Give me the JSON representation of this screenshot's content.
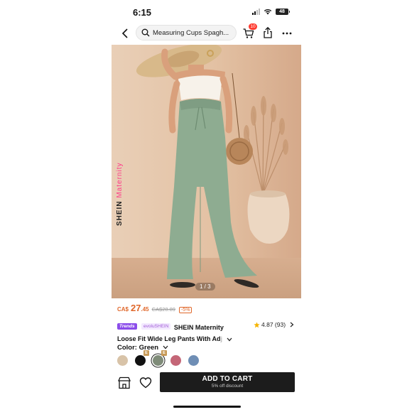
{
  "status_bar": {
    "time": "6:15",
    "battery": "48"
  },
  "nav": {
    "search_text": "Measuring Cups Spagh...",
    "cart_count": "10"
  },
  "hero": {
    "watermark_brand": "SHEIN",
    "watermark_accent": "Maternity",
    "page_indicator": "1 / 3"
  },
  "product": {
    "price_prefix": "CA$",
    "price_main": "27",
    "price_cents": ".45",
    "price_old": "CA$28.89",
    "discount": "-5%",
    "trends_badge": "Trends",
    "brand_badge": "evoluSHEIN",
    "title_line1": "SHEIN Maternity",
    "title_line2": "Loose Fit Wide Leg Pants With Ad",
    "title_fade": "j",
    "rating": "4.87 (93)",
    "color_label": "Color: Green"
  },
  "swatches": [
    {
      "name": "beige",
      "color": "#d8c3a8",
      "tag": ""
    },
    {
      "name": "black",
      "color": "#111111",
      "tag": "E"
    },
    {
      "name": "green",
      "color": "#7f8c79",
      "tag": "E",
      "selected": true
    },
    {
      "name": "pink",
      "color": "#c46677",
      "tag": ""
    },
    {
      "name": "blue",
      "color": "#6f8eb5",
      "tag": ""
    }
  ],
  "bottom": {
    "add_to_cart": "ADD TO CART",
    "add_to_cart_sub": "5% off discount"
  },
  "colors": {
    "price_accent": "#e0672a",
    "button_bg": "#1c1c1c",
    "badge_red": "#ff3b30",
    "trends_purple": "#8b4dea"
  }
}
